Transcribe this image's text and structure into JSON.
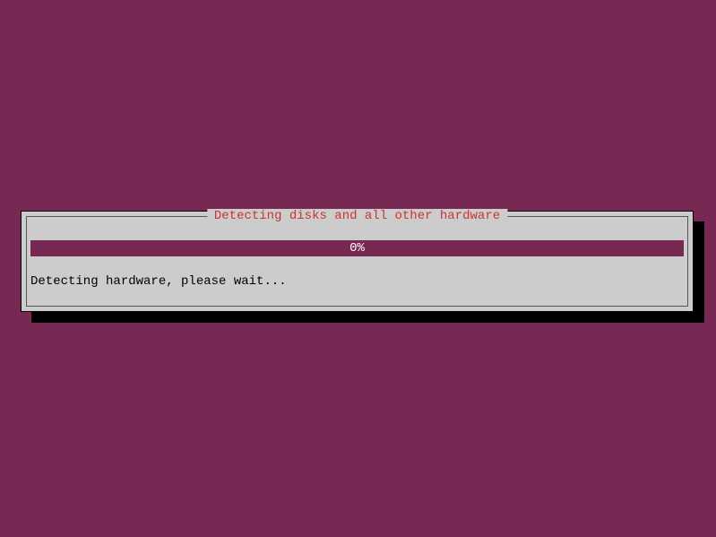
{
  "dialog": {
    "title": "Detecting disks and all other hardware",
    "progress_percent": "0%",
    "status_message": "Detecting hardware, please wait..."
  },
  "colors": {
    "background": "#772953",
    "dialog_bg": "#cccccc",
    "title_color": "#cc3333",
    "progress_bg": "#772953"
  }
}
